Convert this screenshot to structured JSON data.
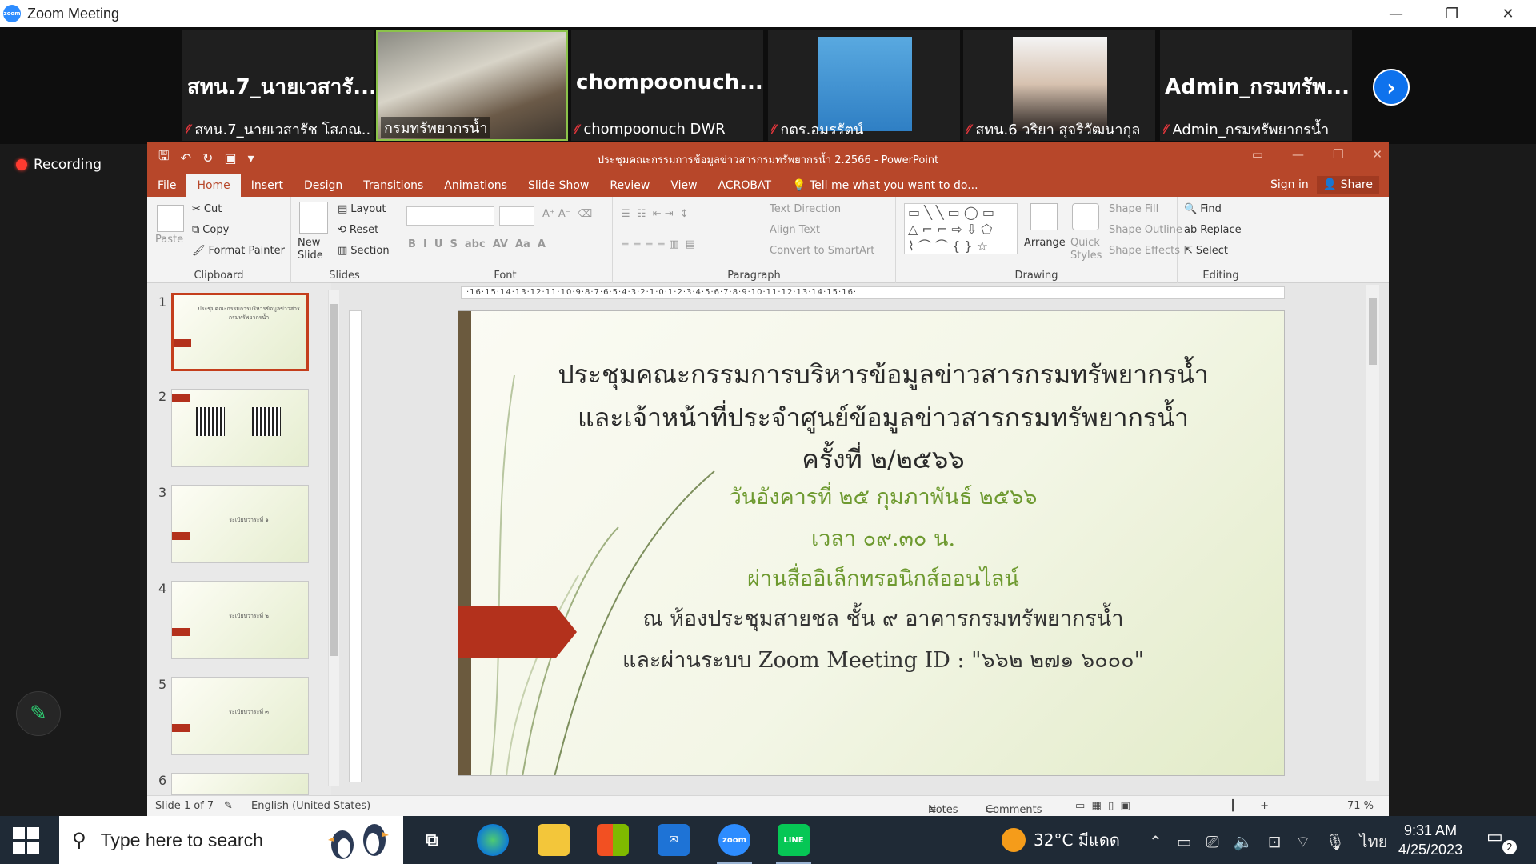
{
  "window": {
    "app_title": "Zoom Meeting",
    "minimize": "—",
    "restore": "❐",
    "close": "✕"
  },
  "participants": [
    {
      "big_name": "สทน.7_นายเวสารั...",
      "label": "สทน.7_นายเวสารัช โสภณ...",
      "muted": true,
      "video": false
    },
    {
      "big_name": "",
      "label": "กรมทรัพยากรน้ำ",
      "muted": false,
      "video": true,
      "active": true
    },
    {
      "big_name": "chompoonuch...",
      "label": "chompoonuch DWR",
      "muted": true,
      "video": false
    },
    {
      "big_name": "",
      "label": "กตร.อมรรัตน์",
      "muted": true,
      "video": true
    },
    {
      "big_name": "",
      "label": "สทน.6 วริยา สุจริวัฒนากุล",
      "muted": true,
      "video": true
    },
    {
      "big_name": "Admin_กรมทรัพ...",
      "label": "Admin_กรมทรัพยากรน้ำ",
      "muted": true,
      "video": false
    }
  ],
  "next_arrow": "›",
  "recording": "Recording",
  "ppt": {
    "doc_title": "ประชุมคณะกรรมการข้อมูลข่าวสารกรมทรัพยากรน้ำ 2.2566  -  PowerPoint",
    "tabs": [
      "File",
      "Home",
      "Insert",
      "Design",
      "Transitions",
      "Animations",
      "Slide Show",
      "Review",
      "View",
      "ACROBAT"
    ],
    "tell_me": "Tell me what you want to do...",
    "sign_in": "Sign in",
    "share": "Share",
    "clipboard": {
      "paste": "Paste",
      "cut": "Cut",
      "copy": "Copy",
      "format_painter": "Format Painter",
      "group": "Clipboard"
    },
    "slides_group": {
      "new_slide": "New Slide",
      "layout": "Layout",
      "reset": "Reset",
      "section": "Section",
      "group": "Slides"
    },
    "font_group": {
      "group": "Font"
    },
    "paragraph_group": {
      "text_direction": "Text Direction",
      "align_text": "Align Text",
      "convert": "Convert to SmartArt",
      "group": "Paragraph"
    },
    "drawing_group": {
      "arrange": "Arrange",
      "quick_styles": "Quick Styles",
      "shape_fill": "Shape Fill",
      "shape_outline": "Shape Outline",
      "shape_effects": "Shape Effects",
      "group": "Drawing"
    },
    "editing_group": {
      "find": "Find",
      "replace": "Replace",
      "select": "Select",
      "group": "Editing"
    },
    "ruler": "·16·15·14·13·12·11·10·9·8·7·6·5·4·3·2·1·0·1·2·3·4·5·6·7·8·9·10·11·12·13·14·15·16·",
    "thumbnails": [
      "1",
      "2",
      "3",
      "4",
      "5",
      "6"
    ],
    "thumb_texts": [
      "ระเบียบวาระที่ ๑",
      "ระเบียบวาระที่ ๒",
      "ระเบียบวาระที่ ๓"
    ],
    "slide_lines": [
      "ประชุมคณะกรรมการบริหารข้อมูลข่าวสารกรมทรัพยากรน้ำ",
      "และเจ้าหน้าที่ประจำศูนย์ข้อมูลข่าวสารกรมทรัพยากรน้ำ",
      "ครั้งที่ ๒/๒๕๖๖",
      "วันอังคารที่ ๒๕ กุมภาพันธ์ ๒๕๖๖",
      "เวลา ๐๙.๓๐ น.",
      "ผ่านสื่ออิเล็กทรอนิกส์ออนไลน์",
      "ณ ห้องประชุมสายชล ชั้น ๙ อาคารกรมทรัพยากรน้ำ",
      "และผ่านระบบ Zoom Meeting ID : \"๖๖๒ ๒๗๑ ๖๐๐๐\""
    ],
    "status": {
      "slide_of": "Slide 1 of 7",
      "language": "English (United States)",
      "notes": "Notes",
      "comments": "Comments",
      "zoom": "71 %"
    }
  },
  "taskbar": {
    "search_placeholder": "Type here to search",
    "weather": "32°C  มีแดด",
    "lang": "ไทย",
    "time": "9:31 AM",
    "date": "4/25/2023",
    "notif_count": "2",
    "zoom_label": "zoom",
    "line_label": "LINE"
  }
}
